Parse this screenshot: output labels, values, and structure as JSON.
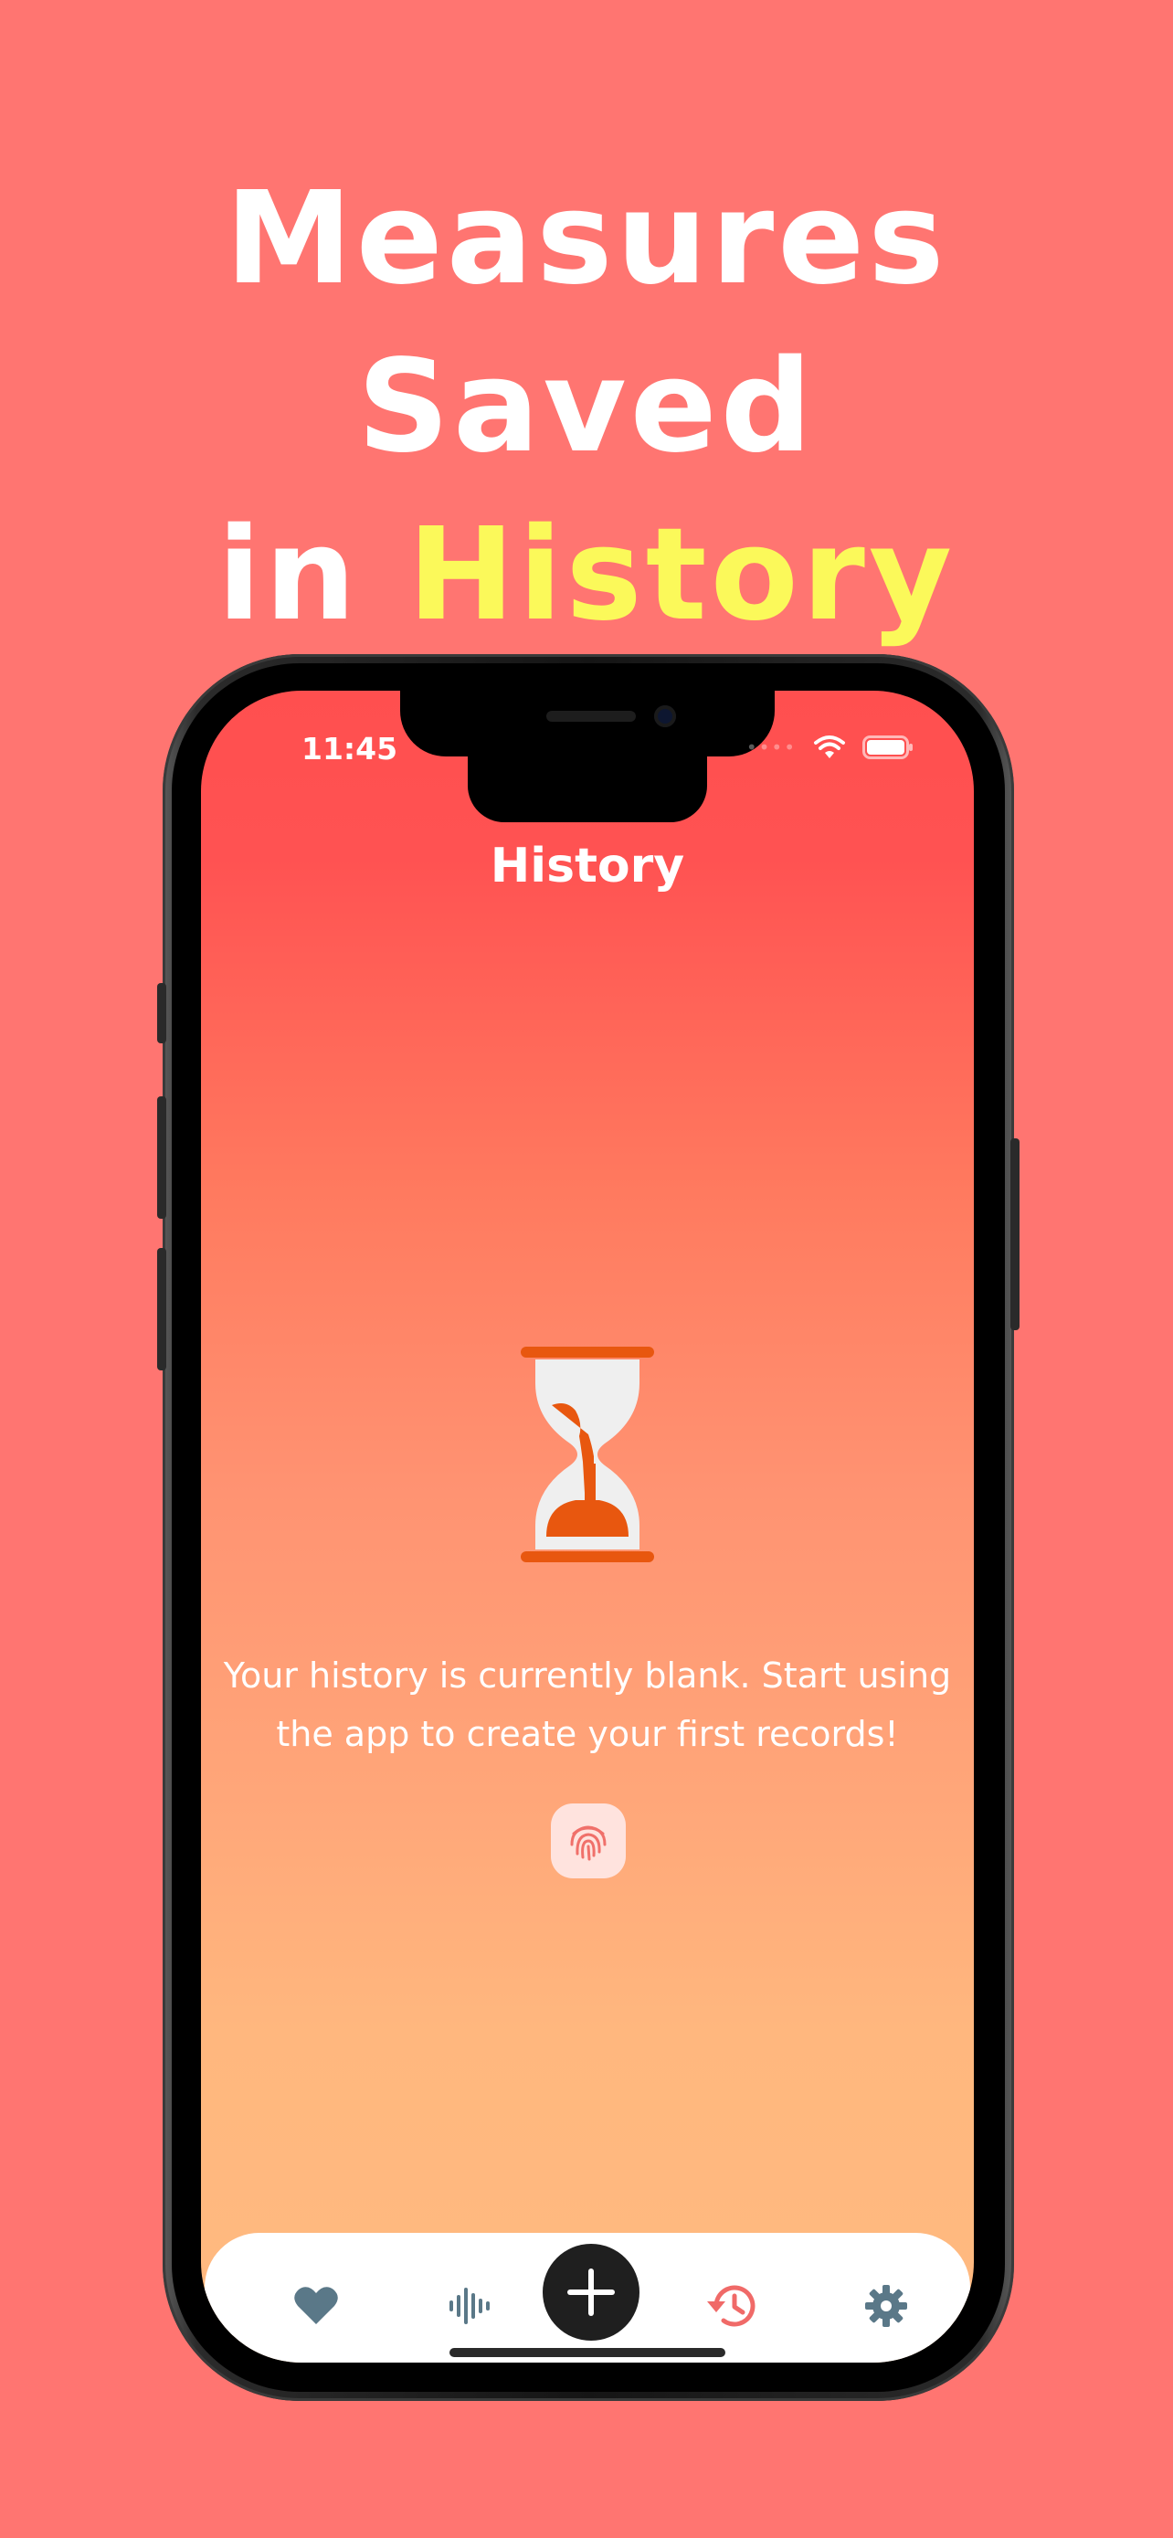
{
  "headline": {
    "line1": "Measures Saved",
    "line2_prefix": "in ",
    "line2_accent": "History"
  },
  "status_bar": {
    "time": "11:45"
  },
  "screen": {
    "title": "History",
    "empty_message": "Your history is currently blank. Start using the app to create your first records!"
  },
  "tabbar": {
    "items": [
      {
        "icon": "heart-icon",
        "active": false
      },
      {
        "icon": "waveform-icon",
        "active": false
      },
      {
        "icon": "plus-icon",
        "active": false
      },
      {
        "icon": "history-icon",
        "active": true
      },
      {
        "icon": "gear-icon",
        "active": false
      }
    ]
  },
  "colors": {
    "background": "#FF7571",
    "accent_text": "#FBF95A",
    "hourglass": "#E8570F",
    "tab_inactive": "#5A7888",
    "tab_active": "#F06A68"
  }
}
